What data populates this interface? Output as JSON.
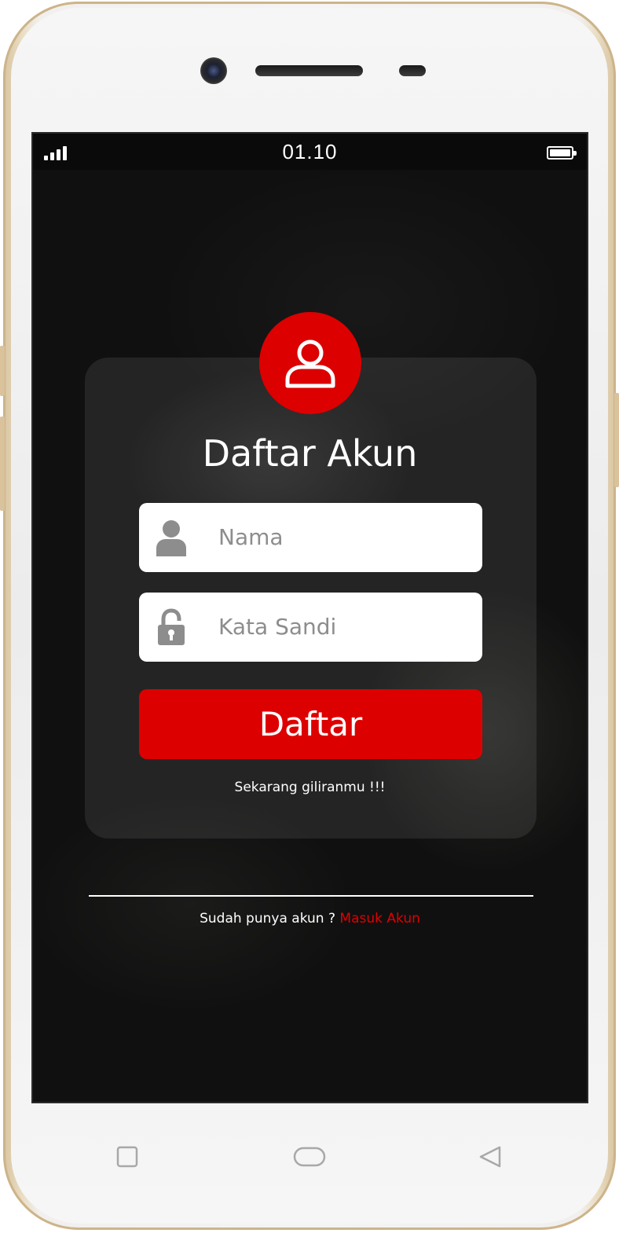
{
  "status_bar": {
    "time": "01.10"
  },
  "register": {
    "title": "Daftar Akun",
    "name_placeholder": "Nama",
    "password_placeholder": "Kata Sandi",
    "submit_label": "Daftar",
    "tagline": "Sekarang giliranmu !!!"
  },
  "footer": {
    "prompt": "Sudah punya akun ? ",
    "login_link": "Masuk Akun"
  },
  "colors": {
    "accent": "#dd0000",
    "link": "#e00000",
    "placeholder": "#8d8d8d"
  },
  "icons": {
    "avatar": "user-outline-icon",
    "name_field": "user-icon",
    "password_field": "padlock-icon",
    "nav": [
      "recent-apps-icon",
      "home-icon",
      "back-icon"
    ]
  }
}
